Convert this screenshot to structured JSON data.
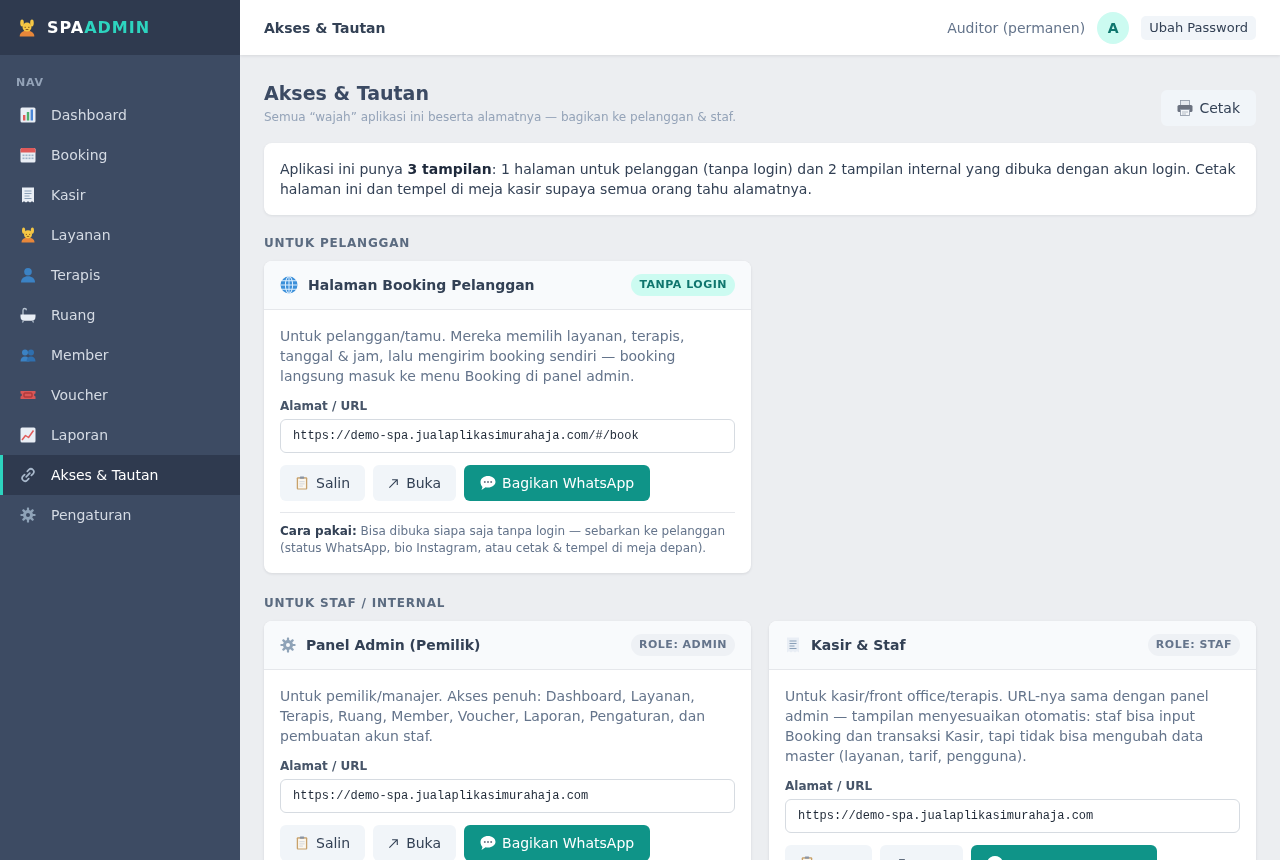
{
  "sidebar": {
    "brand": {
      "name": "SPA",
      "accent": "ADMIN"
    },
    "section_label": "NAV",
    "items": [
      {
        "label": "Dashboard",
        "selected": false
      },
      {
        "label": "Booking",
        "selected": false
      },
      {
        "label": "Kasir",
        "selected": false
      },
      {
        "label": "Layanan",
        "selected": false
      },
      {
        "label": "Terapis",
        "selected": false
      },
      {
        "label": "Ruang",
        "selected": false
      },
      {
        "label": "Member",
        "selected": false
      },
      {
        "label": "Voucher",
        "selected": false
      },
      {
        "label": "Laporan",
        "selected": false
      },
      {
        "label": "Akses & Tautan",
        "selected": true
      },
      {
        "label": "Pengaturan",
        "selected": false
      }
    ]
  },
  "header": {
    "title": "Akses & Tautan",
    "user": "Auditor (permanen)",
    "avatar": "A",
    "button": "Ubah Password"
  },
  "page": {
    "title": "Akses & Tautan",
    "subtitle": "Semua “wajah” aplikasi ini beserta alamatnya — bagikan ke pelanggan & staf.",
    "print_button": "Cetak"
  },
  "intro": "Aplikasi ini punya **3 tampilan**: 1 halaman untuk pelanggan (tanpa login) dan 2 tampilan internal yang dibuka dengan akun login. Cetak halaman ini dan tempel di meja kasir supaya semua orang tahu alamatnya.",
  "sections": [
    {
      "title": "UNTUK PELANGGAN",
      "cards": [
        {
          "kind": "customer",
          "title": "Halaman Booking Pelanggan",
          "badge": "TANPA LOGIN",
          "description": "Untuk pelanggan/tamu. Mereka memilih layanan, terapis, tanggal & jam, lalu mengirim booking sendiri — booking langsung masuk ke menu Booking di panel admin.",
          "url_label": "Alamat / URL",
          "url": "https://demo-spa.jualaplikasimurahaja.com/#/book",
          "buttons": [
            {
              "kind": "copy",
              "label": "Salin"
            },
            {
              "kind": "open",
              "label": "Buka"
            },
            {
              "kind": "share",
              "label": "Bagikan WhatsApp"
            }
          ],
          "note": "**Cara pakai:** Bisa dibuka siapa saja tanpa login — sebarkan ke pelanggan (status WhatsApp, bio Instagram, atau cetak & tempel di meja depan)."
        }
      ]
    },
    {
      "title": "UNTUK STAF / INTERNAL",
      "cards": [
        {
          "kind": "admin",
          "title": "Panel Admin (Pemilik)",
          "badge": "ROLE: ADMIN",
          "description": "Untuk pemilik/manajer. Akses penuh: Dashboard, Layanan, Terapis, Ruang, Member, Voucher, Laporan, Pengaturan, dan pembuatan akun staf.",
          "url_label": "Alamat / URL",
          "url": "https://demo-spa.jualaplikasimurahaja.com",
          "buttons": [
            {
              "kind": "copy",
              "label": "Salin"
            },
            {
              "kind": "open",
              "label": "Buka"
            },
            {
              "kind": "share",
              "label": "Bagikan WhatsApp"
            }
          ]
        },
        {
          "kind": "staff",
          "title": "Kasir & Staf",
          "badge": "ROLE: STAF",
          "description": "Untuk kasir/front office/terapis. URL-nya sama dengan panel admin — tampilan menyesuaikan otomatis: staf bisa input Booking dan transaksi Kasir, tapi tidak bisa mengubah data master (layanan, tarif, pengguna).",
          "url_label": "Alamat / URL",
          "url": "https://demo-spa.jualaplikasimurahaja.com",
          "buttons": [
            {
              "kind": "copy"
            },
            {
              "kind": "open"
            },
            {
              "kind": "share"
            }
          ]
        }
      ]
    }
  ]
}
